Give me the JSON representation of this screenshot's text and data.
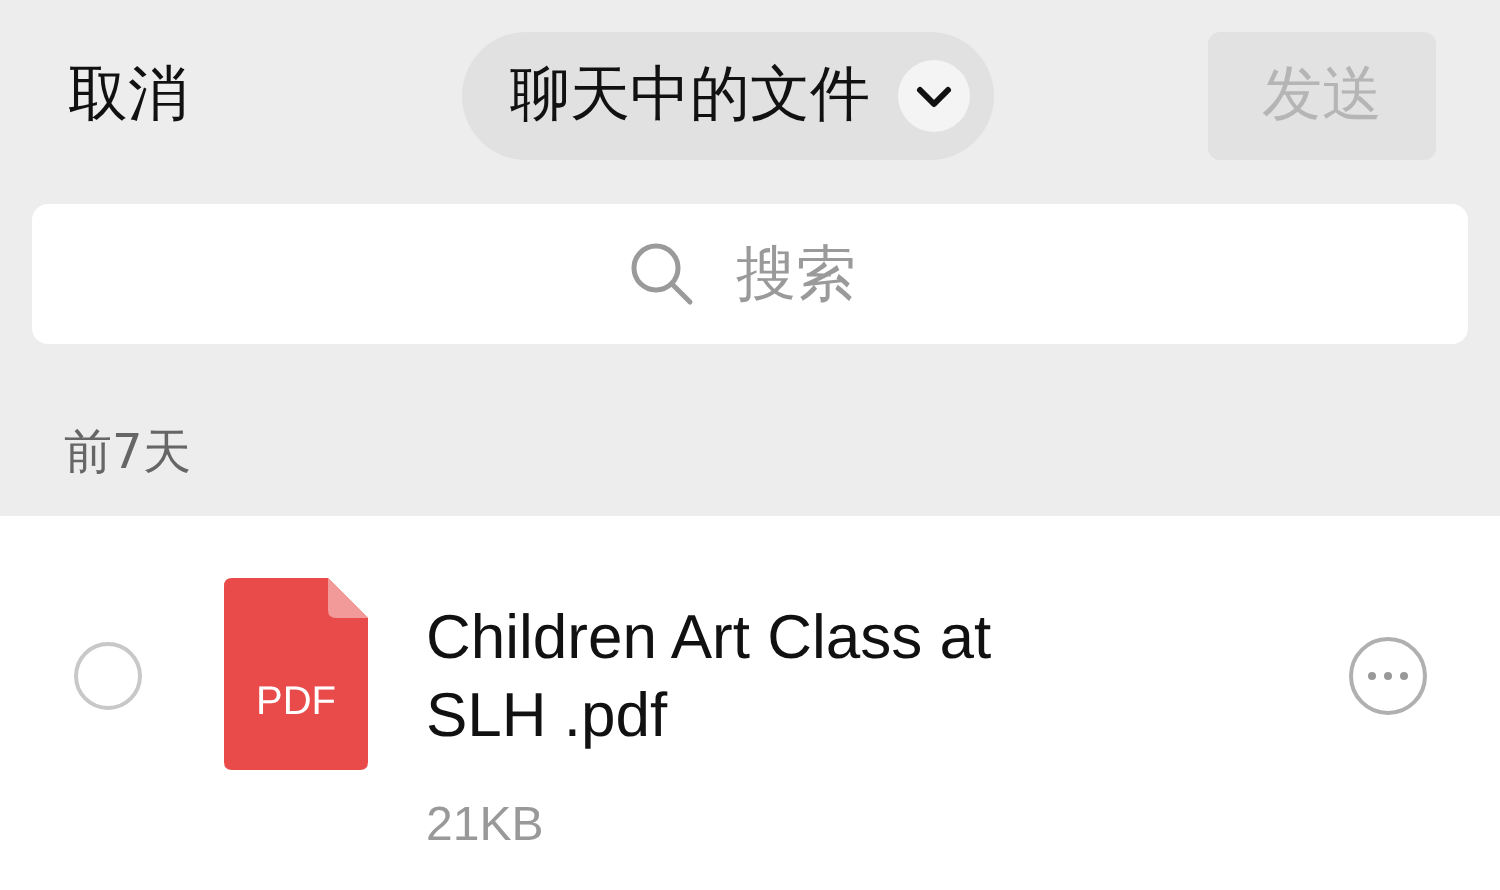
{
  "header": {
    "cancel": "取消",
    "title": "聊天中的文件",
    "send": {
      "label": "发送",
      "disabled": true
    }
  },
  "search": {
    "placeholder": "搜索"
  },
  "section": "前7天",
  "files": [
    {
      "name": "Children Art Class at SLH .pdf",
      "type": "PDF",
      "size": "21KB",
      "selected": false
    }
  ]
}
